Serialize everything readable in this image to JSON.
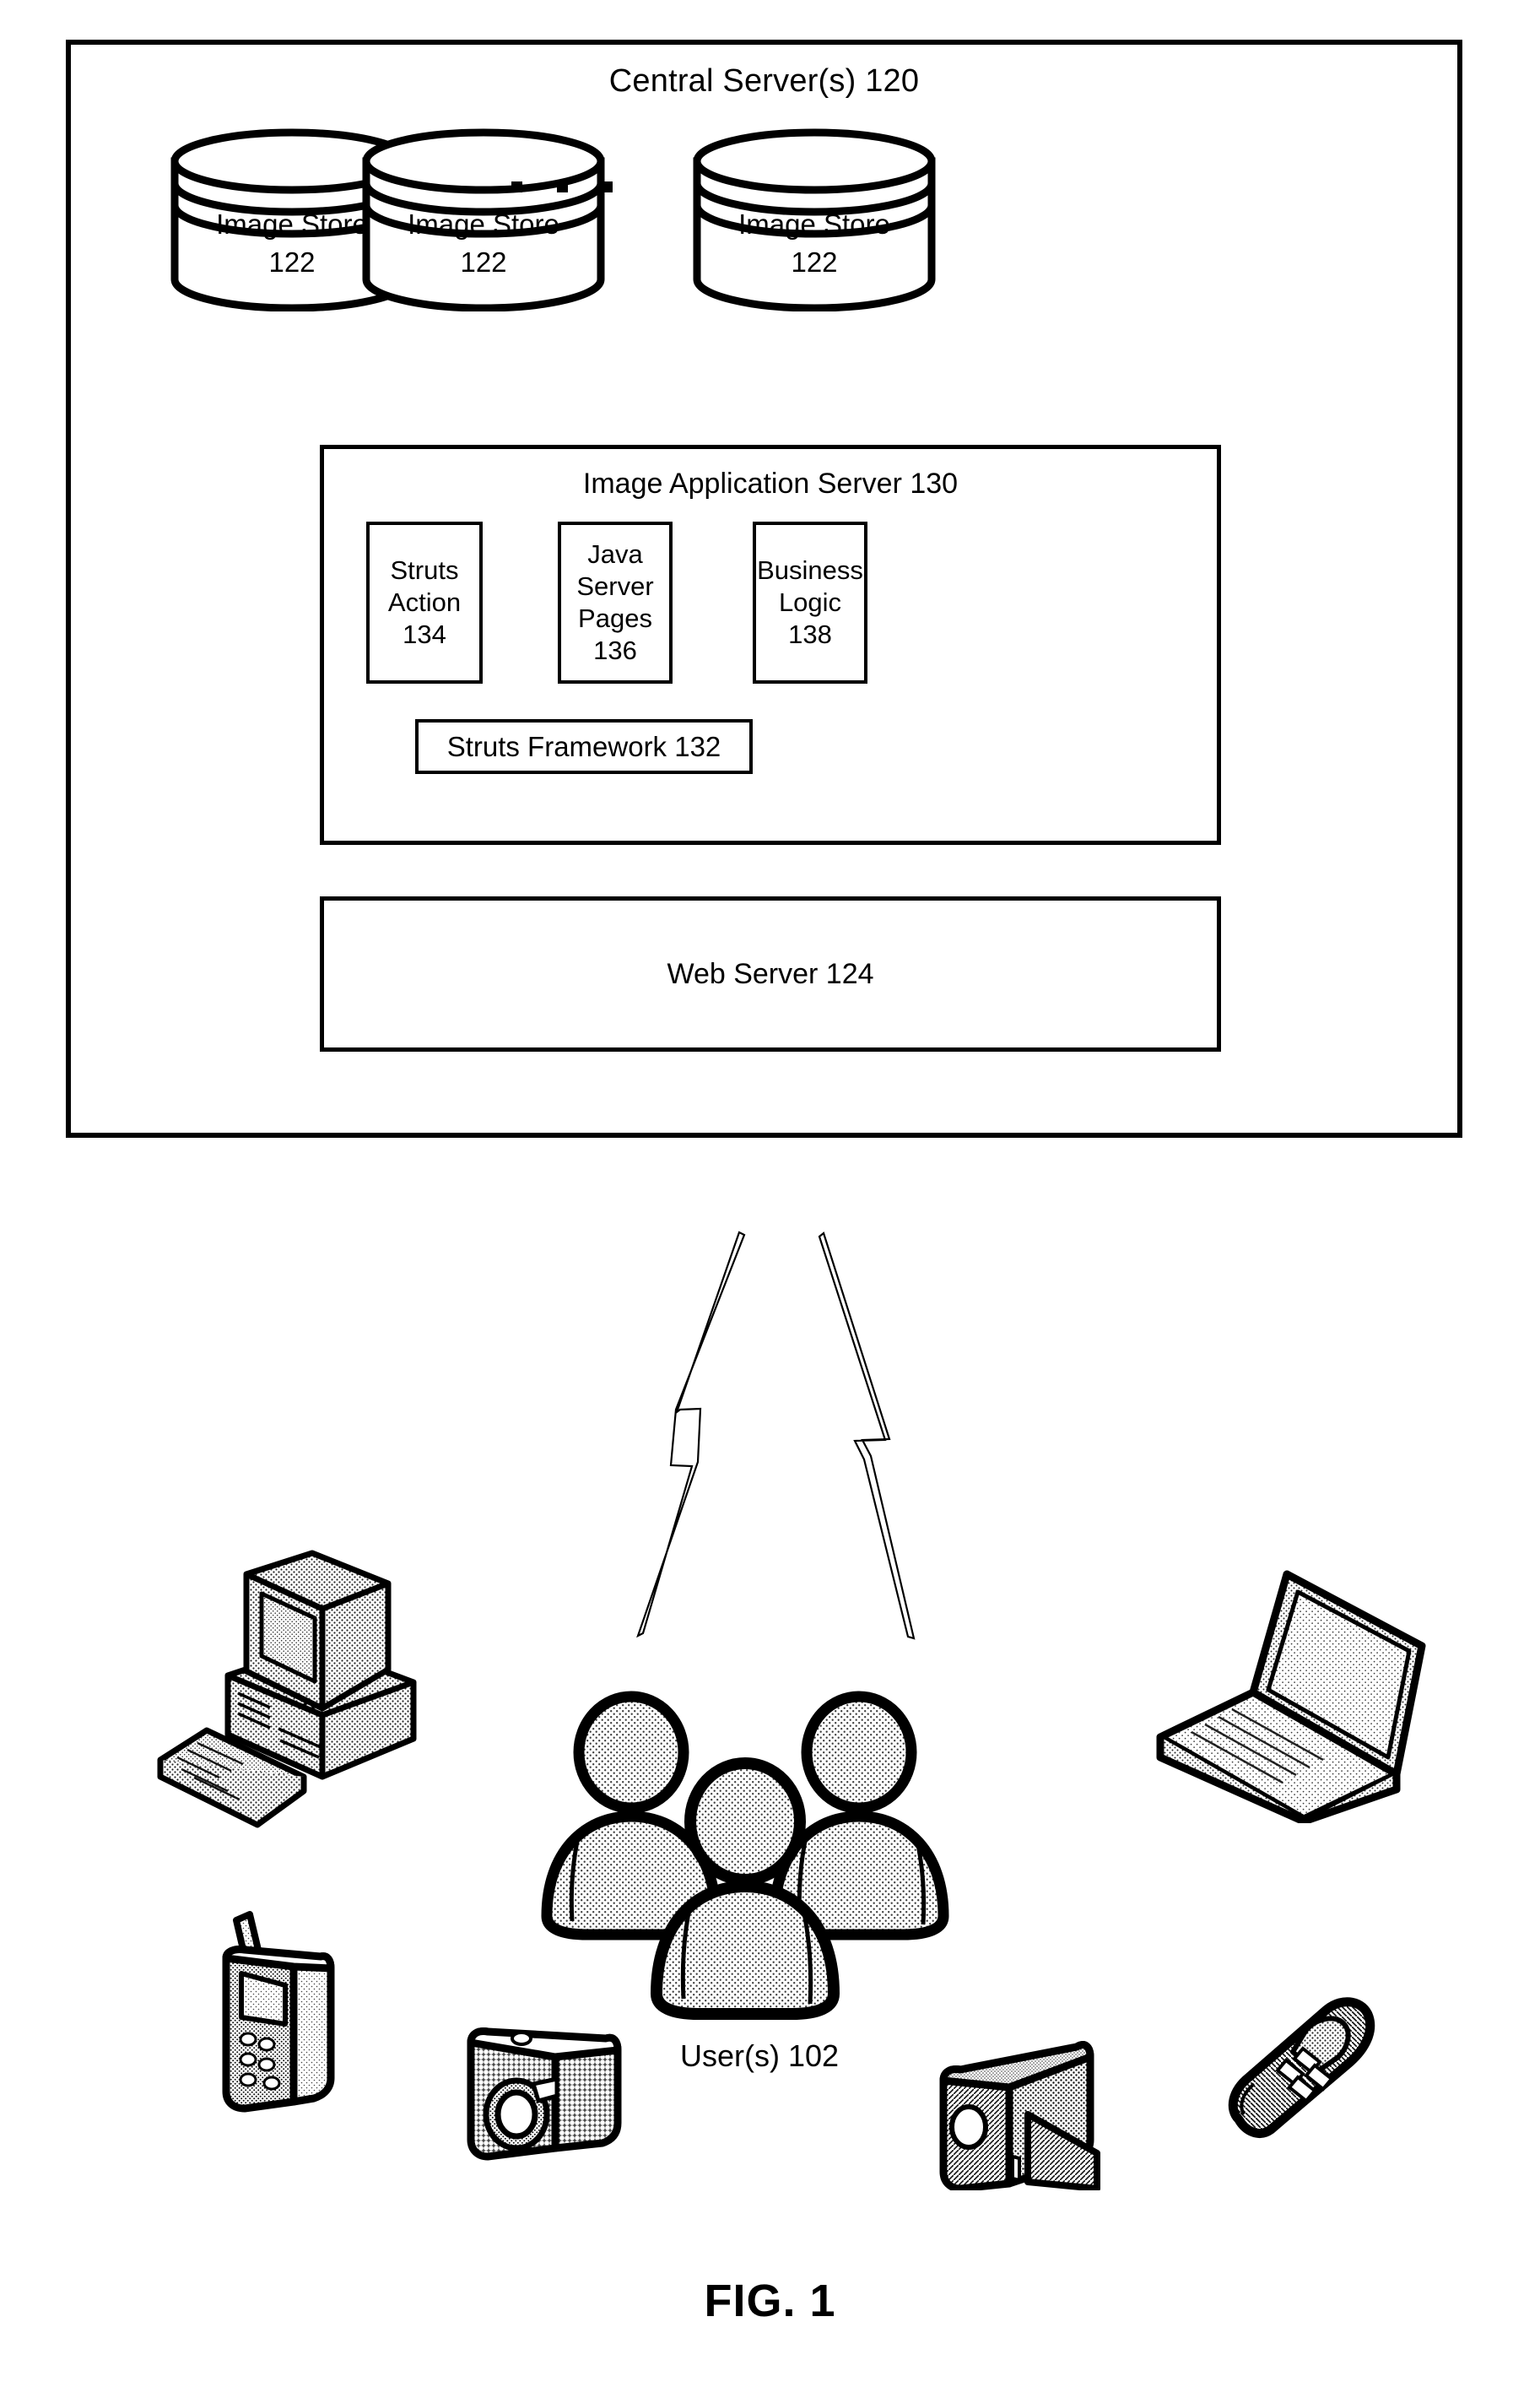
{
  "figure": {
    "caption": "FIG. 1"
  },
  "central_server": {
    "title": "Central Server(s) 120",
    "image_stores": [
      {
        "name": "Image Store",
        "ref": "122"
      },
      {
        "name": "Image Store",
        "ref": "122"
      },
      {
        "name": "Image Store",
        "ref": "122"
      }
    ],
    "ellipsis": "...",
    "app_server": {
      "title": "Image Application Server 130",
      "modules": [
        {
          "label": "Struts\nAction\n134"
        },
        {
          "label": "Java\nServer\nPages\n136"
        },
        {
          "label": "Business\nLogic\n138"
        }
      ],
      "framework": "Struts Framework 132"
    },
    "web_server": {
      "title": "Web Server 124"
    }
  },
  "clients": {
    "users_label": "User(s) 102",
    "connection_icons": [
      "lightning-bolt-left",
      "lightning-bolt-right"
    ],
    "devices": [
      {
        "name": "desktop-computer-icon"
      },
      {
        "name": "laptop-computer-icon"
      },
      {
        "name": "mobile-phone-icon"
      },
      {
        "name": "digital-camera-icon"
      },
      {
        "name": "camcorder-icon"
      },
      {
        "name": "flip-phone-icon"
      },
      {
        "name": "users-group-icon"
      }
    ]
  },
  "colors": {
    "line": "#000000",
    "background": "#ffffff",
    "stipple": "#555555"
  }
}
